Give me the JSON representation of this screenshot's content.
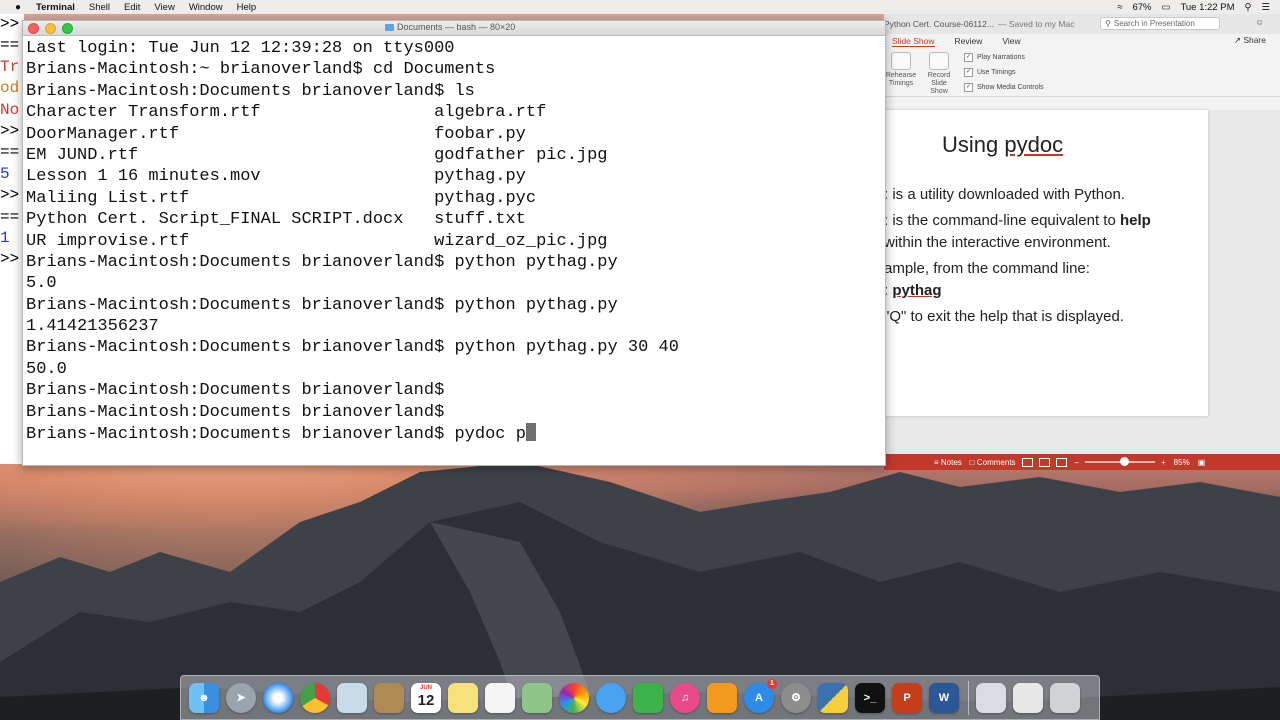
{
  "menubar": {
    "apple": "",
    "app_name": "Terminal",
    "items": [
      "Shell",
      "Edit",
      "View",
      "Window",
      "Help"
    ],
    "battery": "67%",
    "clock": "Tue 1:22 PM"
  },
  "python_shell": {
    "lines": [
      {
        "text": ">>",
        "color": "#000000"
      },
      {
        "text": "==",
        "color": "#000000"
      },
      {
        "text": "Tr",
        "color": "#d23a2f"
      },
      {
        "text": "od",
        "color": "#d07a18"
      },
      {
        "text": "No",
        "color": "#d23a2f"
      },
      {
        "text": ">>",
        "color": "#000000"
      },
      {
        "text": "==",
        "color": "#000000"
      },
      {
        "text": "5",
        "color": "#1d3bd6"
      },
      {
        "text": ">>",
        "color": "#000000"
      },
      {
        "text": "==",
        "color": "#000000"
      },
      {
        "text": "1",
        "color": "#1d3bd6"
      },
      {
        "text": ">>",
        "color": "#000000"
      }
    ]
  },
  "terminal": {
    "title": "Documents — bash — 80×20",
    "lines": [
      "Last login: Tue Jun 12 12:39:28 on ttys000",
      "Brians-Macintosh:~ brianoverland$ cd Documents",
      "Brians-Macintosh:Documents brianoverland$ ls",
      "Character Transform.rtf                 algebra.rtf",
      "DoorManager.rtf                         foobar.py",
      "EM JUND.rtf                             godfather pic.jpg",
      "Lesson 1 16 minutes.mov                 pythag.py",
      "Maliing List.rtf                        pythag.pyc",
      "Python Cert. Script_FINAL SCRIPT.docx   stuff.txt",
      "UR improvise.rtf                        wizard_oz_pic.jpg",
      "Brians-Macintosh:Documents brianoverland$ python pythag.py",
      "5.0",
      "Brians-Macintosh:Documents brianoverland$ python pythag.py",
      "1.41421356237",
      "Brians-Macintosh:Documents brianoverland$ python pythag.py 30 40",
      "50.0",
      "Brians-Macintosh:Documents brianoverland$",
      "Brians-Macintosh:Documents brianoverland$"
    ],
    "prompt": "Brians-Macintosh:Documents brianoverland$ ",
    "current_input": "pydoc p"
  },
  "powerpoint": {
    "doc_title": "Python Cert. Course-06112...",
    "saved_status": "— Saved to my Mac",
    "search_placeholder": "Search in Presentation",
    "tabs": [
      "Slide Show",
      "Review",
      "View"
    ],
    "active_tab": "Slide Show",
    "share_label": "Share",
    "ribbon": {
      "rehearse_label": "Rehearse Timings",
      "record_label": "Record Slide Show",
      "checkboxes": [
        "Play Narrations",
        "Use Timings",
        "Show Media Controls"
      ]
    },
    "slide": {
      "title_prefix": "Using ",
      "title_word": "pydoc",
      "lines": [
        {
          "pre": ": is a utility downloaded with Python.",
          "bold": ""
        },
        {
          "pre": ": is the command-line equivalent to ",
          "bold": "help"
        },
        {
          "pre": "within the interactive environment.",
          "bold": ""
        },
        {
          "pre": "ample, from the command line:",
          "bold": ""
        },
        {
          "pre": ": ",
          "bold": "pythag"
        },
        {
          "pre": "\"Q\" to exit the help that is displayed.",
          "bold": ""
        }
      ]
    },
    "status": {
      "notes_label": "Notes",
      "comments_label": "Comments",
      "zoom": "85%",
      "zoom_level": 0.5
    },
    "accent_color": "#c0392b"
  },
  "dock": {
    "calendar_month": "JUN",
    "calendar_day": "12",
    "appstore_badge": "1",
    "icons": [
      "finder-icon",
      "launchpad-icon",
      "safari-icon",
      "chrome-icon",
      "preview-icon",
      "contacts-icon",
      "calendar-icon",
      "notes-icon",
      "reminders-icon",
      "maps-icon",
      "photos-icon",
      "messages-icon",
      "facetime-icon",
      "itunes-icon",
      "ibooks-icon",
      "appstore-icon",
      "system-preferences-icon",
      "python-icon",
      "terminal-icon",
      "powerpoint-icon",
      "word-icon",
      "folder-icon",
      "documents-icon",
      "trash-icon"
    ]
  }
}
